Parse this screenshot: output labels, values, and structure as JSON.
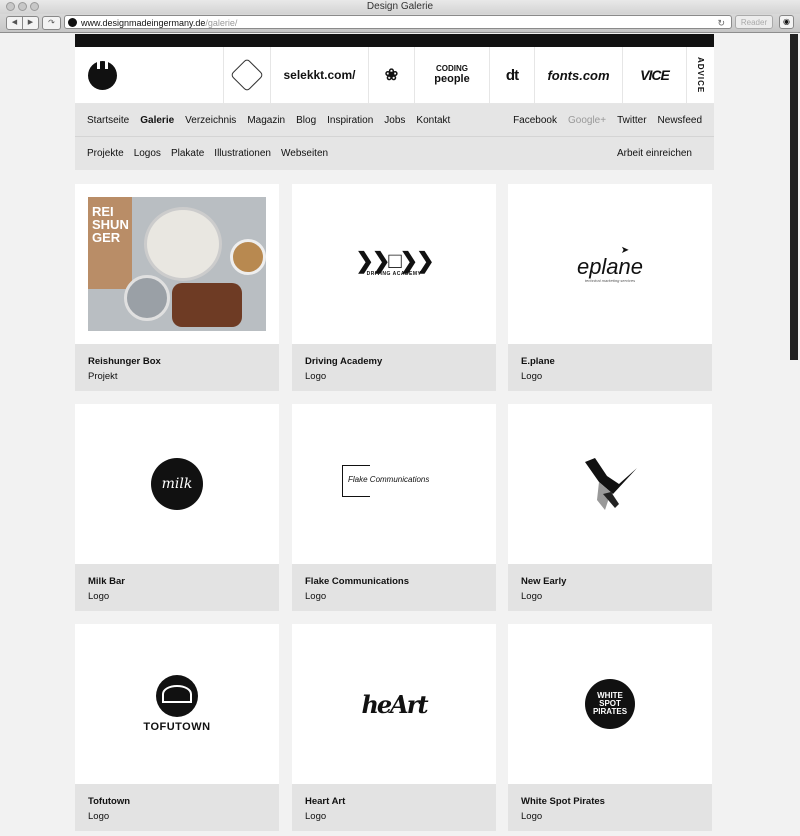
{
  "window": {
    "title": "Design Galerie"
  },
  "browser": {
    "url_host": "www.designmadeingermany.de",
    "url_path": "/galerie/",
    "reader_label": "Reader"
  },
  "sponsors": {
    "selekkt": "selekkt.com/",
    "coding_top": "CODING",
    "coding_bottom": "people",
    "dt": "dt",
    "fonts": "fonts.com",
    "vice": "VICE",
    "advice": "ADVICE"
  },
  "nav_primary": {
    "items": [
      "Startseite",
      "Galerie",
      "Verzeichnis",
      "Magazin",
      "Blog",
      "Inspiration",
      "Jobs",
      "Kontakt"
    ],
    "social": [
      "Facebook",
      "Google+",
      "Twitter",
      "Newsfeed"
    ]
  },
  "nav_secondary": {
    "items": [
      "Projekte",
      "Logos",
      "Plakate",
      "Illustrationen",
      "Webseiten"
    ],
    "submit": "Arbeit einreichen"
  },
  "gallery": [
    {
      "title": "Reishunger Box",
      "category": "Projekt",
      "art": "REI\nSHUN\nGER"
    },
    {
      "title": "Driving Academy",
      "category": "Logo",
      "art": "DRIVING ACADEMY"
    },
    {
      "title": "E.plane",
      "category": "Logo",
      "art": "eplane",
      "art_sub": "technical marketing services"
    },
    {
      "title": "Milk Bar",
      "category": "Logo",
      "art": "milk"
    },
    {
      "title": "Flake Communications",
      "category": "Logo",
      "art": "Flake Communications"
    },
    {
      "title": "New Early",
      "category": "Logo",
      "art": ""
    },
    {
      "title": "Tofutown",
      "category": "Logo",
      "art": "TOFUTOWN"
    },
    {
      "title": "Heart Art",
      "category": "Logo",
      "art": "heArt"
    },
    {
      "title": "White Spot Pirates",
      "category": "Logo",
      "art": "WHITE SPOT PIRATES"
    }
  ]
}
